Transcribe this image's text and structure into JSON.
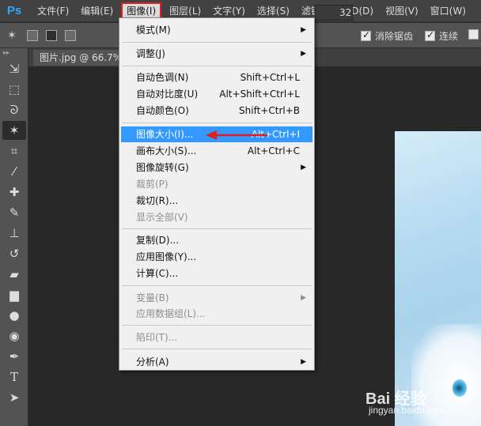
{
  "app": {
    "logo": "Ps"
  },
  "menubar": {
    "items": [
      {
        "label": "文件(F)"
      },
      {
        "label": "编辑(E)"
      },
      {
        "label": "图像(I)"
      },
      {
        "label": "图层(L)"
      },
      {
        "label": "文字(Y)"
      },
      {
        "label": "选择(S)"
      },
      {
        "label": "滤镜(T)"
      },
      {
        "label": "3D(D)"
      },
      {
        "label": "视图(V)"
      },
      {
        "label": "窗口(W)"
      }
    ],
    "active_index": 2
  },
  "options": {
    "tolerance_value": "32",
    "antialias_label": "消除锯齿",
    "antialias_checked": true,
    "contiguous_label": "连续",
    "contiguous_checked": true
  },
  "document": {
    "tab_title": "图片.jpg @ 66.7%"
  },
  "image_menu": {
    "items": [
      {
        "label": "模式(M)",
        "shortcut": "",
        "submenu": true,
        "disabled": false
      },
      {
        "label": "调整(J)",
        "shortcut": "",
        "submenu": true,
        "disabled": false
      },
      {
        "label": "自动色调(N)",
        "shortcut": "Shift+Ctrl+L",
        "submenu": false,
        "disabled": false
      },
      {
        "label": "自动对比度(U)",
        "shortcut": "Alt+Shift+Ctrl+L",
        "submenu": false,
        "disabled": false
      },
      {
        "label": "自动颜色(O)",
        "shortcut": "Shift+Ctrl+B",
        "submenu": false,
        "disabled": false
      },
      {
        "label": "图像大小(I)...",
        "shortcut": "Alt+Ctrl+I",
        "submenu": false,
        "disabled": false,
        "highlighted": true
      },
      {
        "label": "画布大小(S)...",
        "shortcut": "Alt+Ctrl+C",
        "submenu": false,
        "disabled": false
      },
      {
        "label": "图像旋转(G)",
        "shortcut": "",
        "submenu": true,
        "disabled": false
      },
      {
        "label": "裁剪(P)",
        "shortcut": "",
        "submenu": false,
        "disabled": true
      },
      {
        "label": "裁切(R)...",
        "shortcut": "",
        "submenu": false,
        "disabled": false
      },
      {
        "label": "显示全部(V)",
        "shortcut": "",
        "submenu": false,
        "disabled": true
      },
      {
        "label": "复制(D)...",
        "shortcut": "",
        "submenu": false,
        "disabled": false
      },
      {
        "label": "应用图像(Y)...",
        "shortcut": "",
        "submenu": false,
        "disabled": false
      },
      {
        "label": "计算(C)...",
        "shortcut": "",
        "submenu": false,
        "disabled": false
      },
      {
        "label": "变量(B)",
        "shortcut": "",
        "submenu": true,
        "disabled": true
      },
      {
        "label": "应用数据组(L)...",
        "shortcut": "",
        "submenu": false,
        "disabled": true
      },
      {
        "label": "陷印(T)...",
        "shortcut": "",
        "submenu": false,
        "disabled": true
      },
      {
        "label": "分析(A)",
        "shortcut": "",
        "submenu": true,
        "disabled": false
      }
    ]
  },
  "tools": [
    "move-tool-icon",
    "marquee-tool-icon",
    "lasso-tool-icon",
    "magic-wand-tool-icon",
    "crop-tool-icon",
    "eyedropper-tool-icon",
    "healing-brush-tool-icon",
    "brush-tool-icon",
    "clone-stamp-tool-icon",
    "history-brush-tool-icon",
    "eraser-tool-icon",
    "gradient-tool-icon",
    "blur-tool-icon",
    "dodge-tool-icon",
    "pen-tool-icon",
    "type-tool-icon",
    "path-selection-tool-icon"
  ],
  "watermark": {
    "main": "Bai 经验",
    "sub": "jingyan.baidu.com"
  },
  "colors": {
    "highlight": "#3399ff",
    "annotation": "#e02020",
    "menubar": "#424242",
    "panel": "#535353"
  }
}
